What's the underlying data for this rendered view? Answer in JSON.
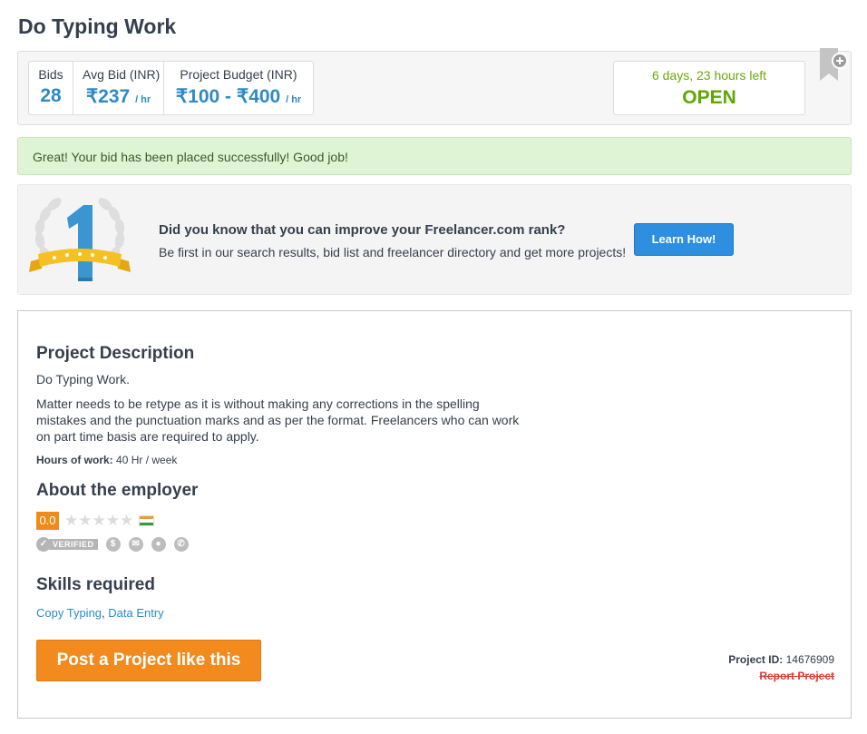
{
  "page": {
    "title": "Do Typing Work"
  },
  "stats": {
    "bids_label": "Bids",
    "bids_value": "28",
    "avg_label": "Avg Bid (INR)",
    "avg_value": "₹237",
    "avg_unit": "/ hr",
    "budget_label": "Project Budget (INR)",
    "budget_value": "₹100 - ₹400",
    "budget_unit": "/ hr"
  },
  "status": {
    "time_left": "6 days, 23 hours left",
    "state": "OPEN"
  },
  "alert": {
    "message": "Great! Your bid has been placed successfully! Good job!"
  },
  "promo": {
    "badge_number": "1",
    "heading": "Did you know that you can improve your Freelancer.com rank?",
    "text": "Be first in our search results, bid list and freelancer directory and get more projects!",
    "button": "Learn How!"
  },
  "description": {
    "heading": "Project Description",
    "lead": "Do Typing Work.",
    "body": "Matter needs to be retype as it is without making any corrections in the spelling mistakes and the punctuation marks and as per the format. Freelancers who can work on part time basis are required to apply.",
    "hours_label": "Hours of work:",
    "hours_value": "40 Hr / week"
  },
  "employer": {
    "heading": "About the employer",
    "rating": "0.0",
    "stars": "★★★★★",
    "verified_label": "VERIFIED"
  },
  "skills": {
    "heading": "Skills required",
    "items": [
      "Copy Typing",
      "Data Entry"
    ],
    "separator": ", "
  },
  "actions": {
    "post_button": "Post a Project like this",
    "project_id_label": "Project ID:",
    "project_id": "14676909",
    "report": "Report Project"
  },
  "colors": {
    "accent_blue": "#2e8ac6",
    "open_green": "#5ea800",
    "orange": "#f28a1d",
    "report_red": "#d93a3a"
  }
}
